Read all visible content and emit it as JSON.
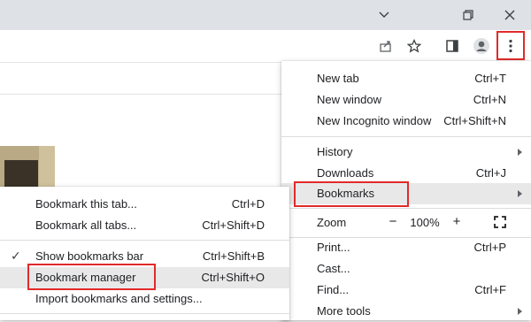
{
  "window": {
    "controls": [
      "chevron-down-icon",
      "restore-icon",
      "close-icon"
    ]
  },
  "toolbar": {
    "icons": [
      "share-icon",
      "star-icon",
      "side-panel-icon",
      "profile-icon",
      "kebab-menu-icon"
    ]
  },
  "main_menu": {
    "items": [
      {
        "label": "New tab",
        "shortcut": "Ctrl+T"
      },
      {
        "label": "New window",
        "shortcut": "Ctrl+N"
      },
      {
        "label": "New Incognito window",
        "shortcut": "Ctrl+Shift+N"
      },
      {
        "label": "History",
        "shortcut": ""
      },
      {
        "label": "Downloads",
        "shortcut": "Ctrl+J"
      },
      {
        "label": "Bookmarks",
        "shortcut": ""
      },
      {
        "label": "Print...",
        "shortcut": "Ctrl+P"
      },
      {
        "label": "Cast...",
        "shortcut": ""
      },
      {
        "label": "Find...",
        "shortcut": "Ctrl+F"
      },
      {
        "label": "More tools",
        "shortcut": ""
      }
    ],
    "zoom": {
      "label": "Zoom",
      "minus": "−",
      "value": "100%",
      "plus": "+"
    }
  },
  "bookmarks_menu": {
    "items": [
      {
        "label": "Bookmark this tab...",
        "shortcut": "Ctrl+D"
      },
      {
        "label": "Bookmark all tabs...",
        "shortcut": "Ctrl+Shift+D"
      },
      {
        "label": "Show bookmarks bar",
        "shortcut": "Ctrl+Shift+B",
        "checked": true
      },
      {
        "label": "Bookmark manager",
        "shortcut": "Ctrl+Shift+O"
      },
      {
        "label": "Import bookmarks and settings...",
        "shortcut": ""
      }
    ]
  },
  "colors": {
    "highlight": "#e12a2a",
    "titlebar": "#dee1e6",
    "hover": "#e8e8e9"
  }
}
